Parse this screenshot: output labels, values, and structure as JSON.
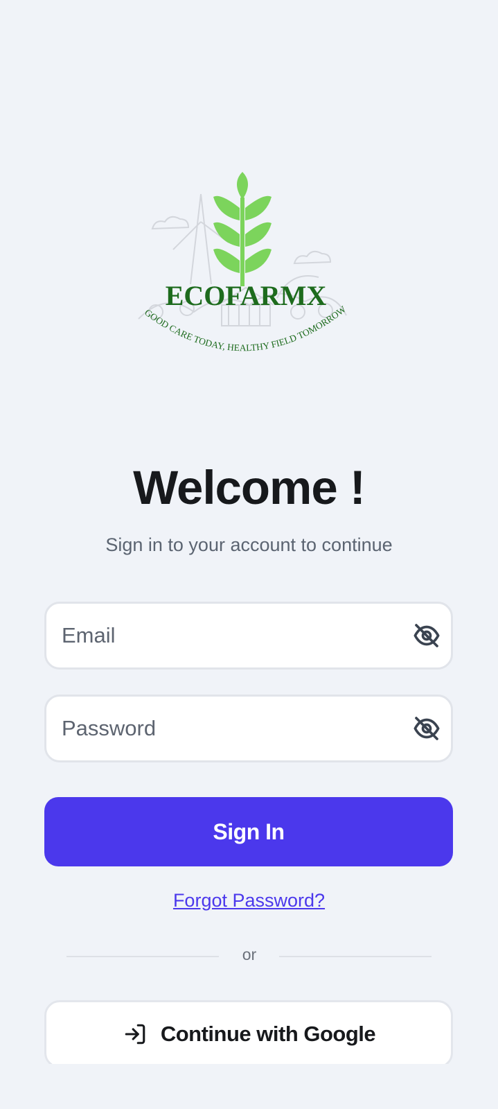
{
  "logo": {
    "brand": "ECOFARMX",
    "tagline": "GOOD CARE TODAY, HEALTHY FIELD TOMORROW",
    "icon": "wheat-leaf-logo",
    "colors": {
      "leaf": "#7cd45c",
      "text": "#1d6b1d",
      "sketch": "#d3d6dc"
    }
  },
  "header": {
    "title": "Welcome !",
    "subtitle": "Sign in to your account to continue"
  },
  "form": {
    "email_placeholder": "Email",
    "password_placeholder": "Password",
    "visibility_icon": "eye-off-icon",
    "sign_in_label": "Sign In",
    "forgot_label": "Forgot Password?"
  },
  "divider": {
    "label": "or"
  },
  "google": {
    "label": "Continue with Google",
    "icon": "login-arrow-icon"
  },
  "colors": {
    "accent": "#4b38ec",
    "background": "#f0f3f8"
  }
}
